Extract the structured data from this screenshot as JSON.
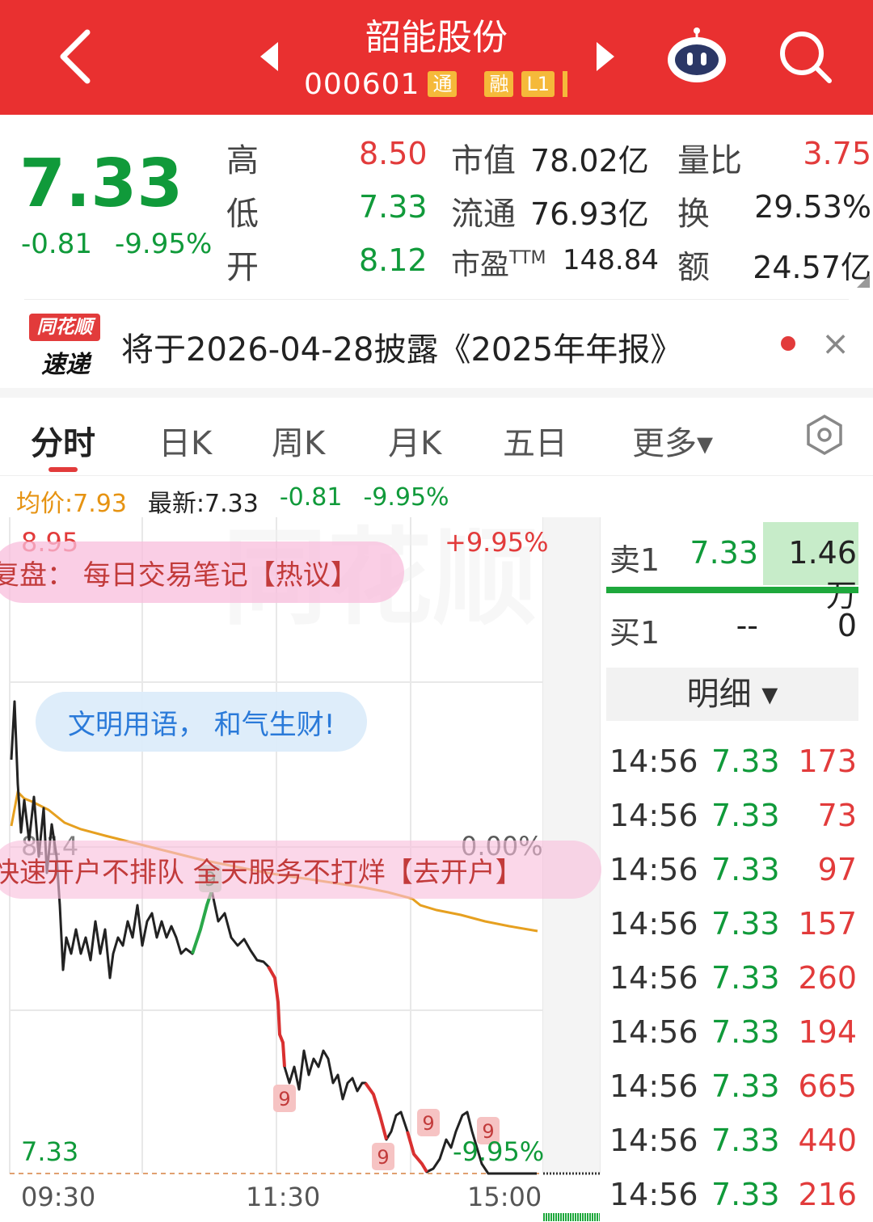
{
  "header": {
    "stock_name": "韶能股份",
    "stock_code": "000601",
    "tags": [
      "通",
      "融",
      "L1"
    ],
    "back_icon": "chevron-left-icon",
    "prev_icon": "triangle-left-icon",
    "next_icon": "triangle-right-icon",
    "assistant_icon": "robot-icon",
    "search_icon": "search-icon"
  },
  "quote": {
    "price": "7.33",
    "change": "-0.81",
    "change_pct": "-9.95%",
    "high_label": "高",
    "high": "8.50",
    "low_label": "低",
    "low": "7.33",
    "open_label": "开",
    "open": "8.12",
    "mktcap_label": "市值",
    "mktcap": "78.02亿",
    "float_label": "流通",
    "float": "76.93亿",
    "pe_label": "市盈",
    "pe_tm": "TTM",
    "pe": "148.84",
    "vol_ratio_label": "量比",
    "vol_ratio": "3.75",
    "turnover_label": "换",
    "turnover": "29.53%",
    "amount_label": "额",
    "amount": "24.57亿"
  },
  "news": {
    "logo_top": "同花顺",
    "logo_bottom": "速递",
    "text": "将于2026-04-28披露《2025年年报》",
    "close": "×"
  },
  "tabs": [
    "分时",
    "日K",
    "周K",
    "月K",
    "五日",
    "更多▾"
  ],
  "active_tab": "分时",
  "chart_info": {
    "avg_label": "均价:7.93",
    "latest_label": "最新:7.33",
    "change": "-0.81",
    "change_pct": "-9.95%"
  },
  "chart": {
    "y_high": "8.95",
    "y_high_pct": "+9.95%",
    "y_mid": "8.14",
    "y_mid_pct": "0.00%",
    "y_low": "7.33",
    "y_low_pct": "-9.95%",
    "x_labels": [
      "09:30",
      "11:30",
      "15:00"
    ],
    "markers": [
      "9",
      "9",
      "9",
      "9",
      "9"
    ],
    "pill_review": "复盘：  每日交易笔记【热议】",
    "pill_civil": "文明用语，  和气生财!",
    "pill_account": "快速开户不排队  全天服务不打烊【去开户】"
  },
  "order_book": {
    "sell1_label": "卖1",
    "sell1_price": "7.33",
    "sell1_vol": "1.46万",
    "buy1_label": "买1",
    "buy1_price": "--",
    "buy1_vol": "0",
    "detail_label": "明细 ▾"
  },
  "ticks": [
    {
      "time": "14:56",
      "price": "7.33",
      "vol": "173"
    },
    {
      "time": "14:56",
      "price": "7.33",
      "vol": "73"
    },
    {
      "time": "14:56",
      "price": "7.33",
      "vol": "97"
    },
    {
      "time": "14:56",
      "price": "7.33",
      "vol": "157"
    },
    {
      "time": "14:56",
      "price": "7.33",
      "vol": "260"
    },
    {
      "time": "14:56",
      "price": "7.33",
      "vol": "194"
    },
    {
      "time": "14:56",
      "price": "7.33",
      "vol": "665"
    },
    {
      "time": "14:56",
      "price": "7.33",
      "vol": "440"
    },
    {
      "time": "14:56",
      "price": "7.33",
      "vol": "216"
    }
  ],
  "colors": {
    "header_bg": "#e93030",
    "down": "#109a3a",
    "up": "#e23b3b",
    "avg_line": "#e6a020"
  }
}
